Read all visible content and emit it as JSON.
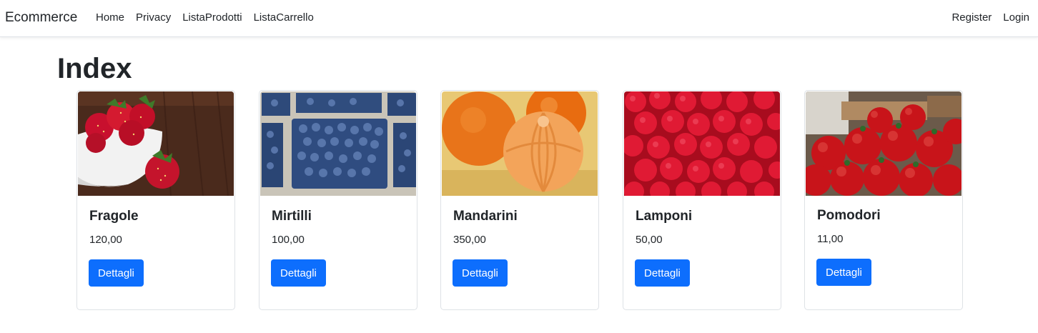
{
  "nav": {
    "brand": "Ecommerce",
    "links": [
      "Home",
      "Privacy",
      "ListaProdotti",
      "ListaCarrello"
    ],
    "right_links": [
      "Register",
      "Login"
    ]
  },
  "page": {
    "title": "Index"
  },
  "products": [
    {
      "name": "Fragole",
      "price": "120,00",
      "button": "Dettagli",
      "image": "strawberries-image"
    },
    {
      "name": "Mirtilli",
      "price": "100,00",
      "button": "Dettagli",
      "image": "blueberries-image"
    },
    {
      "name": "Mandarini",
      "price": "350,00",
      "button": "Dettagli",
      "image": "mandarins-image"
    },
    {
      "name": "Lamponi",
      "price": "50,00",
      "button": "Dettagli",
      "image": "raspberries-image"
    },
    {
      "name": "Pomodori",
      "price": "11,00",
      "button": "Dettagli",
      "image": "tomatoes-image"
    }
  ],
  "colors": {
    "primary": "#0d6efd",
    "border": "#dee2e6",
    "text": "#212529"
  }
}
